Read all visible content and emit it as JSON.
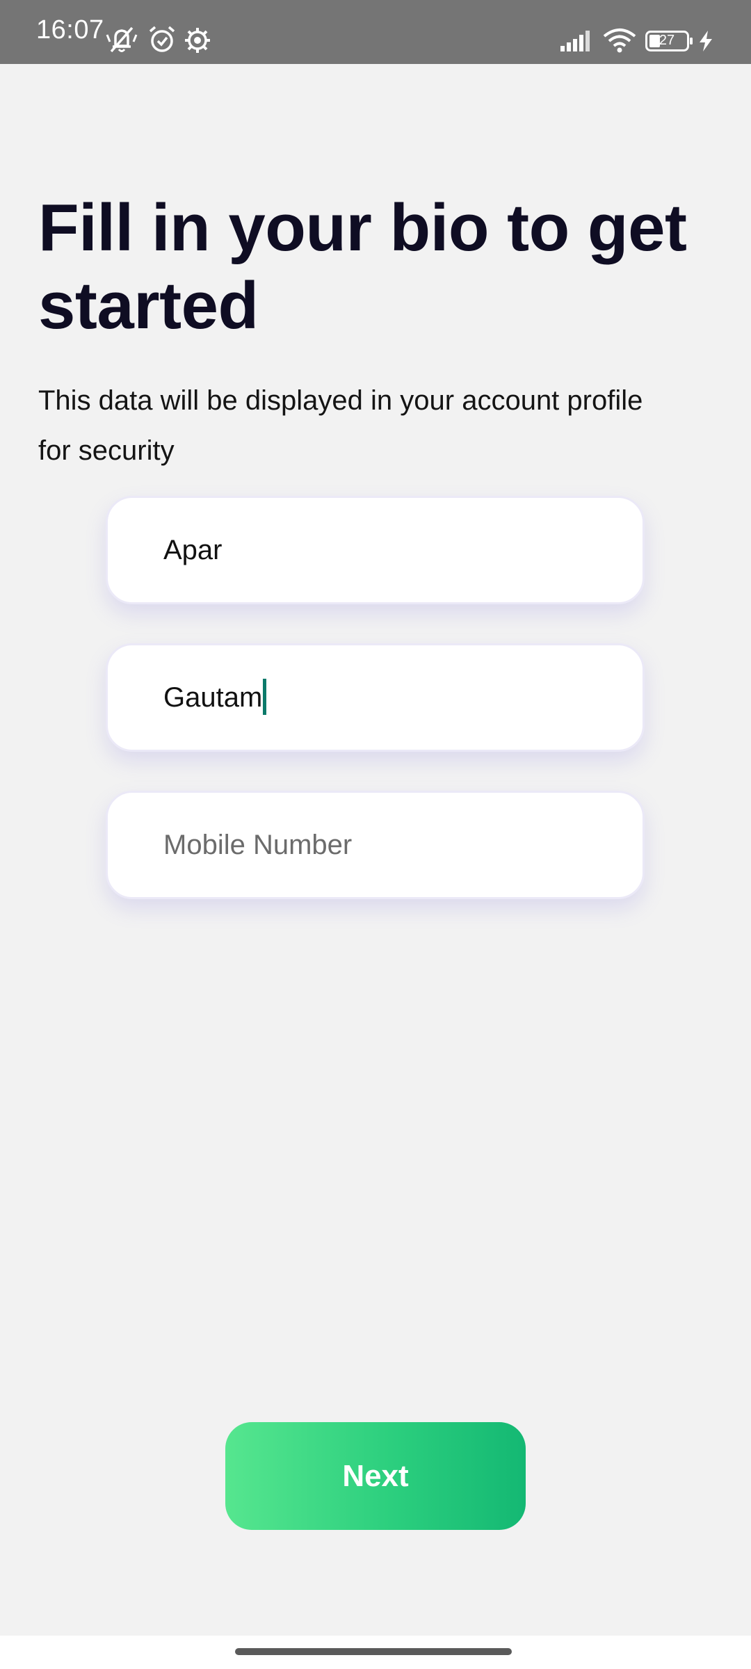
{
  "status_bar": {
    "time": "16:07",
    "battery_level": "27",
    "icons": [
      "mute-icon",
      "alarm-icon",
      "gear-icon",
      "signal-icon",
      "wifi-icon",
      "battery-icon",
      "charging-icon"
    ]
  },
  "header": {
    "title": "Fill in your bio to get started",
    "subtitle": "This data will be displayed in your account profile for security"
  },
  "form": {
    "first_name": {
      "value": "Apar",
      "placeholder": ""
    },
    "last_name": {
      "value": "Gautam",
      "placeholder": ""
    },
    "mobile": {
      "value": "",
      "placeholder": "Mobile Number"
    }
  },
  "actions": {
    "next_label": "Next"
  },
  "colors": {
    "background": "#f2f2f2",
    "title": "#0f0d23",
    "button_start": "#56e68f",
    "button_end": "#14b873",
    "caret": "#0b7a6a"
  }
}
